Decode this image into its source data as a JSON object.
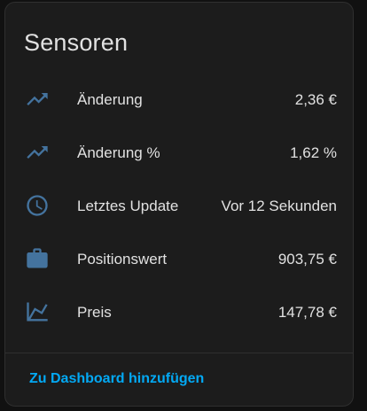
{
  "card": {
    "title": "Sensoren",
    "icon_color": "#44739e",
    "accent_color": "#03a9f4",
    "rows": [
      {
        "icon": "trending-up-icon",
        "label": "Änderung",
        "value": "2,36 €"
      },
      {
        "icon": "trending-up-icon",
        "label": "Änderung %",
        "value": "1,62 %"
      },
      {
        "icon": "clock-icon",
        "label": "Letztes Update",
        "value": "Vor 12 Sekunden"
      },
      {
        "icon": "briefcase-icon",
        "label": "Positionswert",
        "value": "903,75 €"
      },
      {
        "icon": "chart-line-icon",
        "label": "Preis",
        "value": "147,78 €"
      }
    ],
    "footer_link": "Zu Dashboard hinzufügen"
  }
}
